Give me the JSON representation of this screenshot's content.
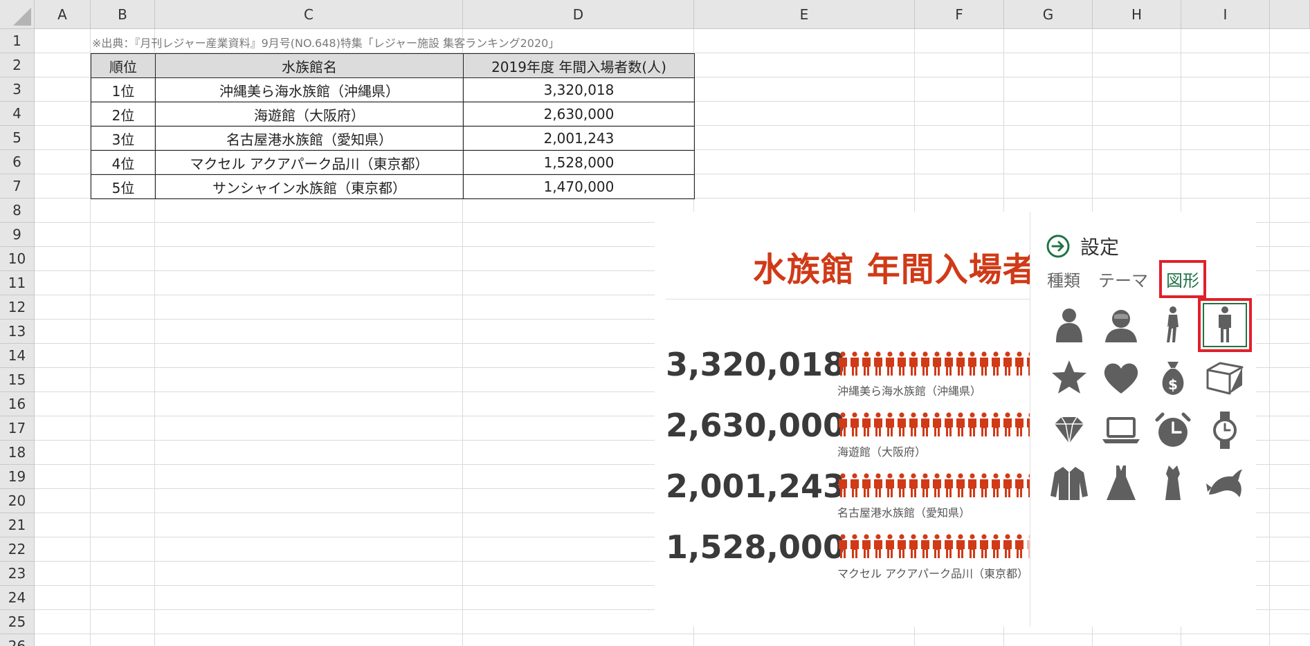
{
  "sheet": {
    "columns": [
      "A",
      "B",
      "C",
      "D",
      "E",
      "F",
      "G",
      "H",
      "I"
    ],
    "rows": [
      "1",
      "2",
      "3",
      "4",
      "5",
      "6",
      "7",
      "8",
      "9",
      "10",
      "11",
      "12",
      "13",
      "14",
      "15",
      "16",
      "17",
      "18",
      "19",
      "20",
      "21",
      "22",
      "23",
      "24",
      "25",
      "26"
    ]
  },
  "source_note": "※出典：『月刊レジャー産業資料』9月号(NO.648)特集「レジャー施設 集客ランキング2020」",
  "table": {
    "headers": {
      "rank": "順位",
      "name": "水族館名",
      "visitors": "2019年度 年間入場者数(人)"
    },
    "rows": [
      {
        "rank": "1位",
        "name": "沖縄美ら海水族館（沖縄県）",
        "visitors": "3,320,018"
      },
      {
        "rank": "2位",
        "name": "海遊館（大阪府）",
        "visitors": "2,630,000"
      },
      {
        "rank": "3位",
        "name": "名古屋港水族館（愛知県）",
        "visitors": "2,001,243"
      },
      {
        "rank": "4位",
        "name": "マクセル アクアパーク品川（東京都）",
        "visitors": "1,528,000"
      },
      {
        "rank": "5位",
        "name": "サンシャイン水族館（東京都）",
        "visitors": "1,470,000"
      }
    ]
  },
  "infographic": {
    "title": "水族館 年間入場者",
    "accent_color": "#d03a17",
    "items": [
      {
        "value": "3,320,018",
        "label": "沖縄美ら海水族館（沖縄県）",
        "fill": 1.0
      },
      {
        "value": "2,630,000",
        "label": "海遊館（大阪府）",
        "fill": 1.0
      },
      {
        "value": "2,001,243",
        "label": "名古屋港水族館（愛知県）",
        "fill": 1.0
      },
      {
        "value": "1,528,000",
        "label": "マクセル アクアパーク品川（東京都）",
        "fill": 0.97
      }
    ]
  },
  "settings": {
    "title": "設定",
    "tabs": [
      "種類",
      "テーマ",
      "図形"
    ],
    "active_tab": "図形",
    "icon_color": "#5f5f5f",
    "accent_color": "#217346",
    "shapes": [
      "person-round-icon",
      "person-bust-icon",
      "person-walking-icon",
      "person-standing-icon",
      "star-icon",
      "heart-icon",
      "money-bag-icon",
      "box-icon",
      "diamond-icon",
      "laptop-icon",
      "alarm-clock-icon",
      "wristwatch-icon",
      "jacket-icon",
      "dress-icon",
      "qipao-dress-icon",
      "dolphin-icon"
    ],
    "selected_shape": "person-standing-icon"
  }
}
